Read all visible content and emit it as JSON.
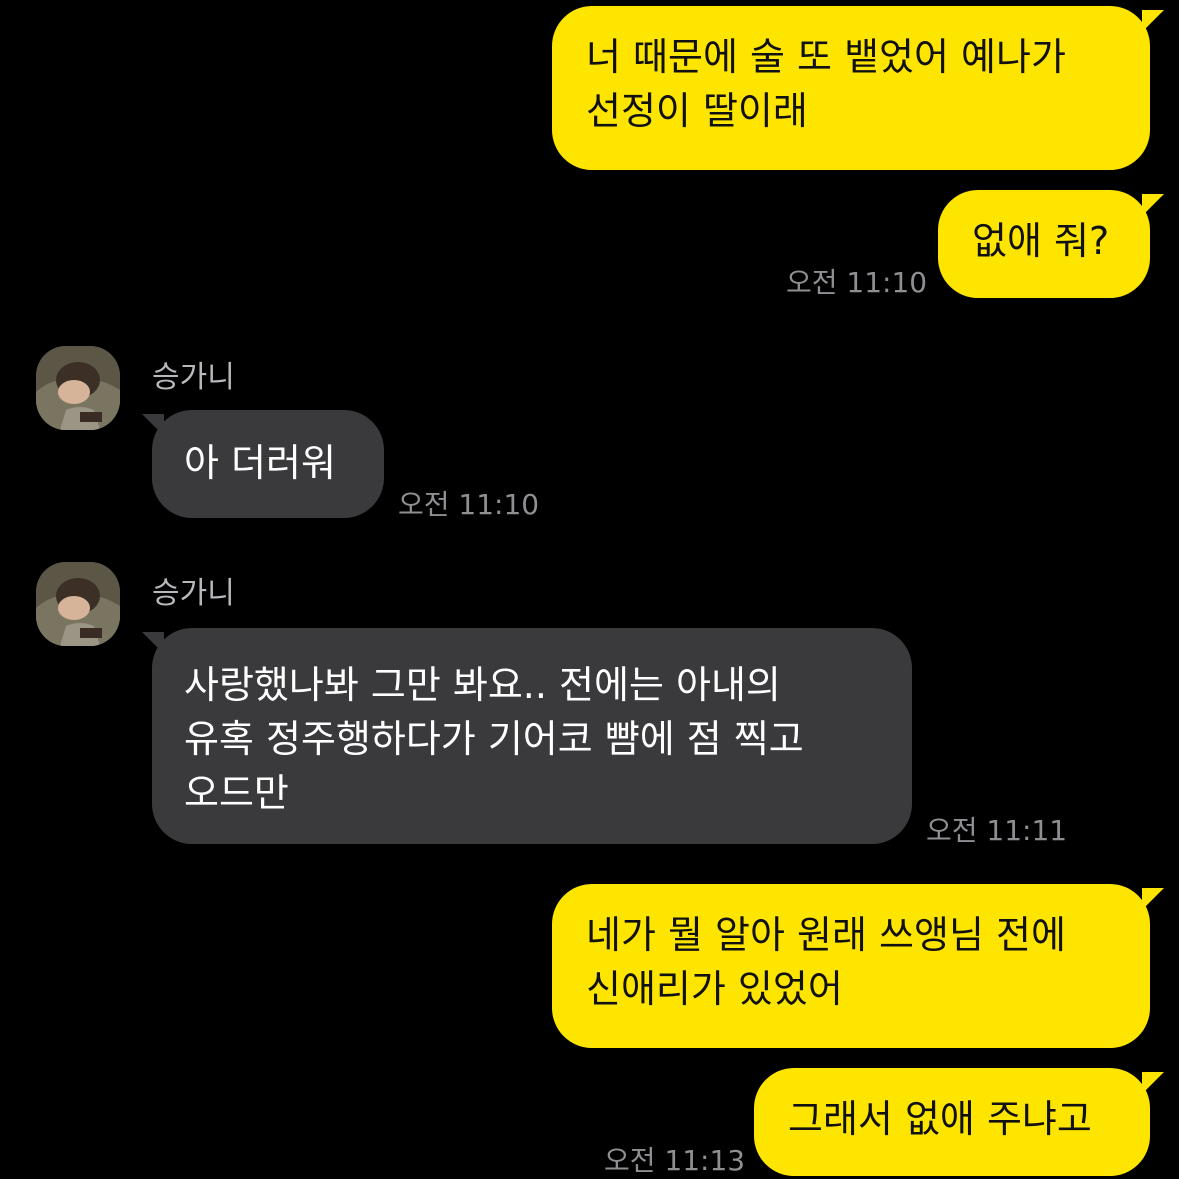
{
  "chat": {
    "contact_name": "승가니",
    "messages": [
      {
        "from": "me",
        "text": "너 때문에 술 또 뱉었어 예나가\n선정이 딸이래"
      },
      {
        "from": "me",
        "text": "없애 줘?",
        "time": "오전 11:10"
      },
      {
        "from": "them",
        "sender": "승가니",
        "text": "아 더러워",
        "time": "오전 11:10"
      },
      {
        "from": "them",
        "sender": "승가니",
        "text": "사랑했나봐 그만 봐요.. 전에는 아내의\n유혹 정주행하다가 기어코 뺨에 점 찍고\n오드만",
        "time": "오전 11:11"
      },
      {
        "from": "me",
        "text": "네가 뭘 알아 원래 쓰앵님 전에\n신애리가 있었어"
      },
      {
        "from": "me",
        "text": "그래서 없애 주냐고",
        "time": "오전 11:13"
      }
    ]
  },
  "colors": {
    "background": "#000000",
    "my_bubble": "#FEE500",
    "their_bubble": "#3A3A3C",
    "timestamp": "#8E8E93"
  },
  "icons": {
    "avatar": "profile-photo-avatar"
  }
}
